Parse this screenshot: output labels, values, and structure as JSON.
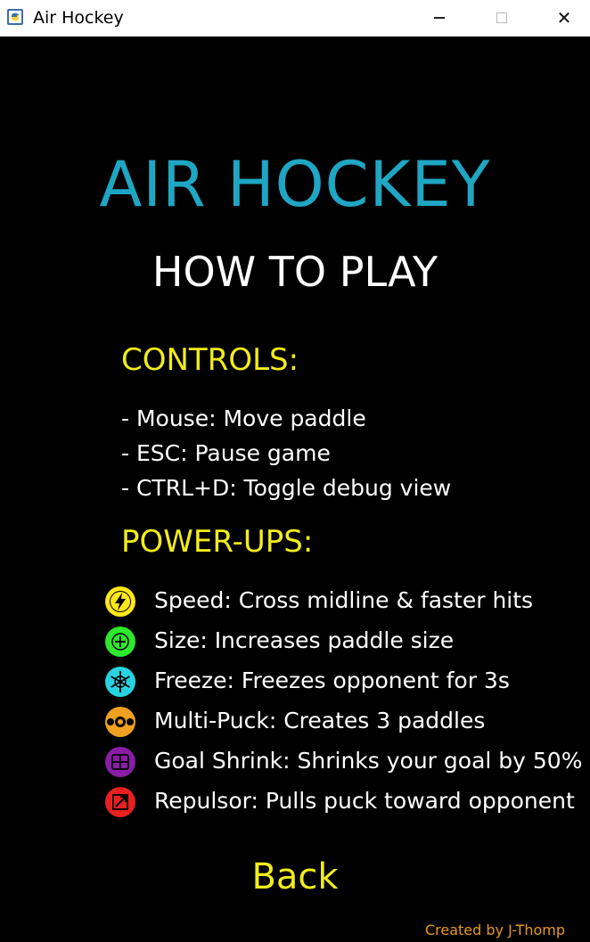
{
  "window": {
    "title": "Air Hockey",
    "icon": "python-icon",
    "controls": {
      "minimize": "minimize-icon",
      "maximize": "maximize-icon",
      "close": "✕"
    }
  },
  "screen": {
    "title": "AIR HOCKEY",
    "subtitle": "HOW TO PLAY",
    "title_color": "#1fa6c4",
    "heading_color": "#f2ec1b",
    "controls_heading": "CONTROLS:",
    "controls": [
      "- Mouse: Move paddle",
      "- ESC: Pause game",
      "- CTRL+D: Toggle debug view"
    ],
    "powerups_heading": "POWER-UPS:",
    "powerups": [
      {
        "icon": "lightning-icon",
        "color": "#ffe81a",
        "text": "Speed: Cross midline & faster hits"
      },
      {
        "icon": "plus-icon",
        "color": "#2ee82e",
        "text": "Size: Increases paddle size"
      },
      {
        "icon": "snowflake-icon",
        "color": "#27d3e0",
        "text": "Freeze: Freezes opponent for 3s"
      },
      {
        "icon": "multi-puck-icon",
        "color": "#f0a020",
        "text": "Multi-Puck: Creates 3 paddles"
      },
      {
        "icon": "goal-shrink-icon",
        "color": "#8a1ca8",
        "text": "Goal Shrink: Shrinks your goal by 50%"
      },
      {
        "icon": "repulsor-icon",
        "color": "#e82020",
        "text": "Repulsor: Pulls puck toward opponent"
      }
    ],
    "back_label": "Back",
    "credit": "Created by J-Thomp"
  }
}
